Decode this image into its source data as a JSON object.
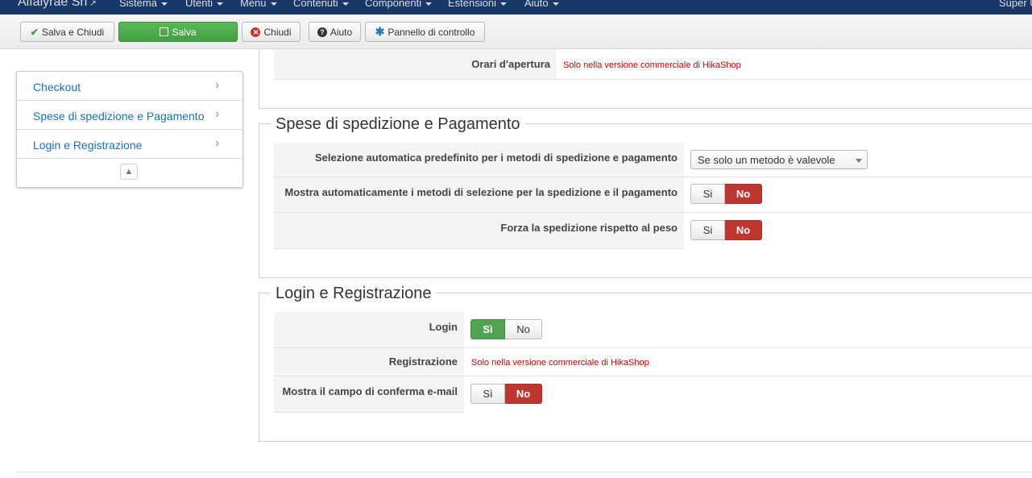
{
  "topbar": {
    "brand": "Alfalyrae Srl",
    "menus": [
      "Sistema",
      "Utenti",
      "Menu",
      "Contenuti",
      "Componenti",
      "Estensioni",
      "Aiuto"
    ],
    "user": "Super U"
  },
  "toolbar": {
    "save_close": "Salva e Chiudi",
    "save": "Salva",
    "close": "Chiudi",
    "help": "Aiuto",
    "control_panel": "Pannello di controllo"
  },
  "sidebar": {
    "items": [
      {
        "label": "Checkout"
      },
      {
        "label": "Spese di spedizione e Pagamento"
      },
      {
        "label": "Login e Registrazione"
      }
    ],
    "toggle_glyph": "▲"
  },
  "top_section": {
    "row_label": "Orari d'apertura",
    "note": "Solo nella versione commerciale di HikaShop"
  },
  "shipping": {
    "legend": "Spese di spedizione e Pagamento",
    "rows": [
      {
        "label": "Selezione automatica predefinito per i metodi di spedizione e pagamento",
        "value": "Se solo un metodo è valevole"
      },
      {
        "label": "Mostra automaticamente i metodi di selezione per la spedizione e il pagamento",
        "yes": "Si",
        "no": "No",
        "selected": "no"
      },
      {
        "label": "Forza la spedizione rispetto al peso",
        "yes": "Si",
        "no": "No",
        "selected": "no"
      }
    ]
  },
  "login": {
    "legend": "Login e Registrazione",
    "rows": [
      {
        "label": "Login",
        "yes": "Sì",
        "no": "No",
        "selected": "yes"
      },
      {
        "label": "Registrazione",
        "note": "Solo nella versione commerciale di HikaShop"
      },
      {
        "label": "Mostra il campo di conferma e-mail",
        "yes": "Sì",
        "no": "No",
        "selected": "no"
      }
    ]
  },
  "colors": {
    "navbar": "#1a3867",
    "link": "#1f6fb0",
    "danger": "#bd362f",
    "success": "#51a351",
    "note_red": "#cc0000"
  }
}
